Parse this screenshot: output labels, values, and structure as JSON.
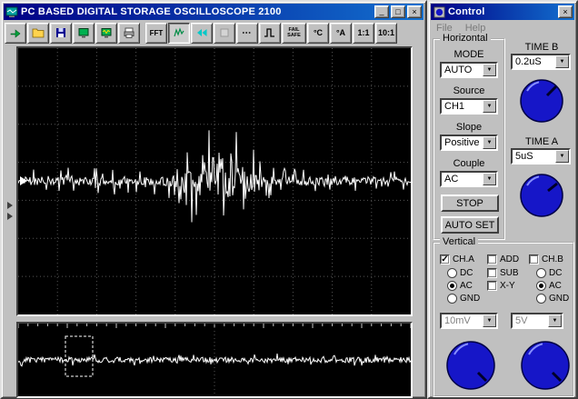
{
  "icons": {
    "dropdown_arrow": "▼",
    "check": "✓",
    "minimize": "_",
    "maximize": "□",
    "close": "×"
  },
  "main_window": {
    "title": "PC BASED DIGITAL STORAGE OSCILLOSCOPE 2100",
    "toolbar": {
      "fft": "FFT",
      "fail_safe": "FAIL SAFE",
      "deg_c": "°C",
      "deg_a": "°A",
      "ratio_1_1": "1:1",
      "ratio_10_1": "10:1"
    }
  },
  "control_window": {
    "title": "Control",
    "menu": {
      "file": "File",
      "help": "Help"
    },
    "horizontal": {
      "title": "Horizontal",
      "mode_label": "MODE",
      "mode_value": "AUTO",
      "source_label": "Source",
      "source_value": "CH1",
      "slope_label": "Slope",
      "slope_value": "Positive",
      "couple_label": "Couple",
      "couple_value": "AC",
      "stop": "STOP",
      "auto_set": "AUTO SET"
    },
    "time_b": {
      "label": "TIME B",
      "value": "0.2uS"
    },
    "time_a": {
      "label": "TIME A",
      "value": "5uS"
    },
    "vertical": {
      "title": "Vertical",
      "ch_a": "CH.A",
      "add": "ADD",
      "ch_b": "CH.B",
      "dc_a": "DC",
      "sub": "SUB",
      "dc_b": "DC",
      "ac_a": "AC",
      "xy": "X-Y",
      "ac_b": "AC",
      "gnd_a": "GND",
      "gnd_b": "GND",
      "volts_a": "10mV",
      "volts_b": "5V"
    }
  },
  "scope": {
    "background": "#000000",
    "grid_color": "#565656",
    "wave_color": "#ffffff"
  }
}
